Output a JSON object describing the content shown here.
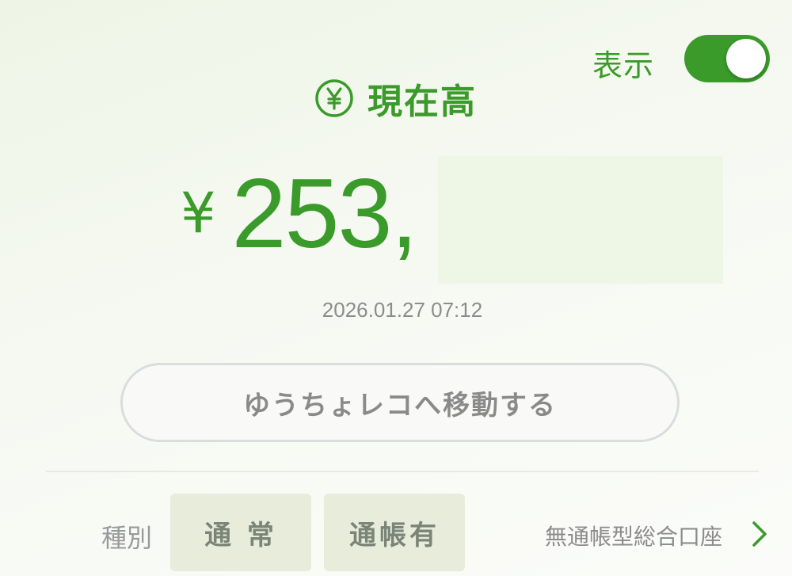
{
  "toggle": {
    "label": "表示",
    "on": true,
    "color": "#3a9a2a"
  },
  "heading": {
    "icon": "yen-circle-icon",
    "title": "現在高"
  },
  "balance": {
    "currency": "¥",
    "amount": "253,",
    "timestamp": "2026.01.27 07:12"
  },
  "actions": {
    "move_label": "ゆうちょレコへ移動する"
  },
  "account": {
    "kind_label": "種別",
    "chips": [
      "通 常",
      "通帳有"
    ],
    "type": "無通帳型総合口座"
  }
}
